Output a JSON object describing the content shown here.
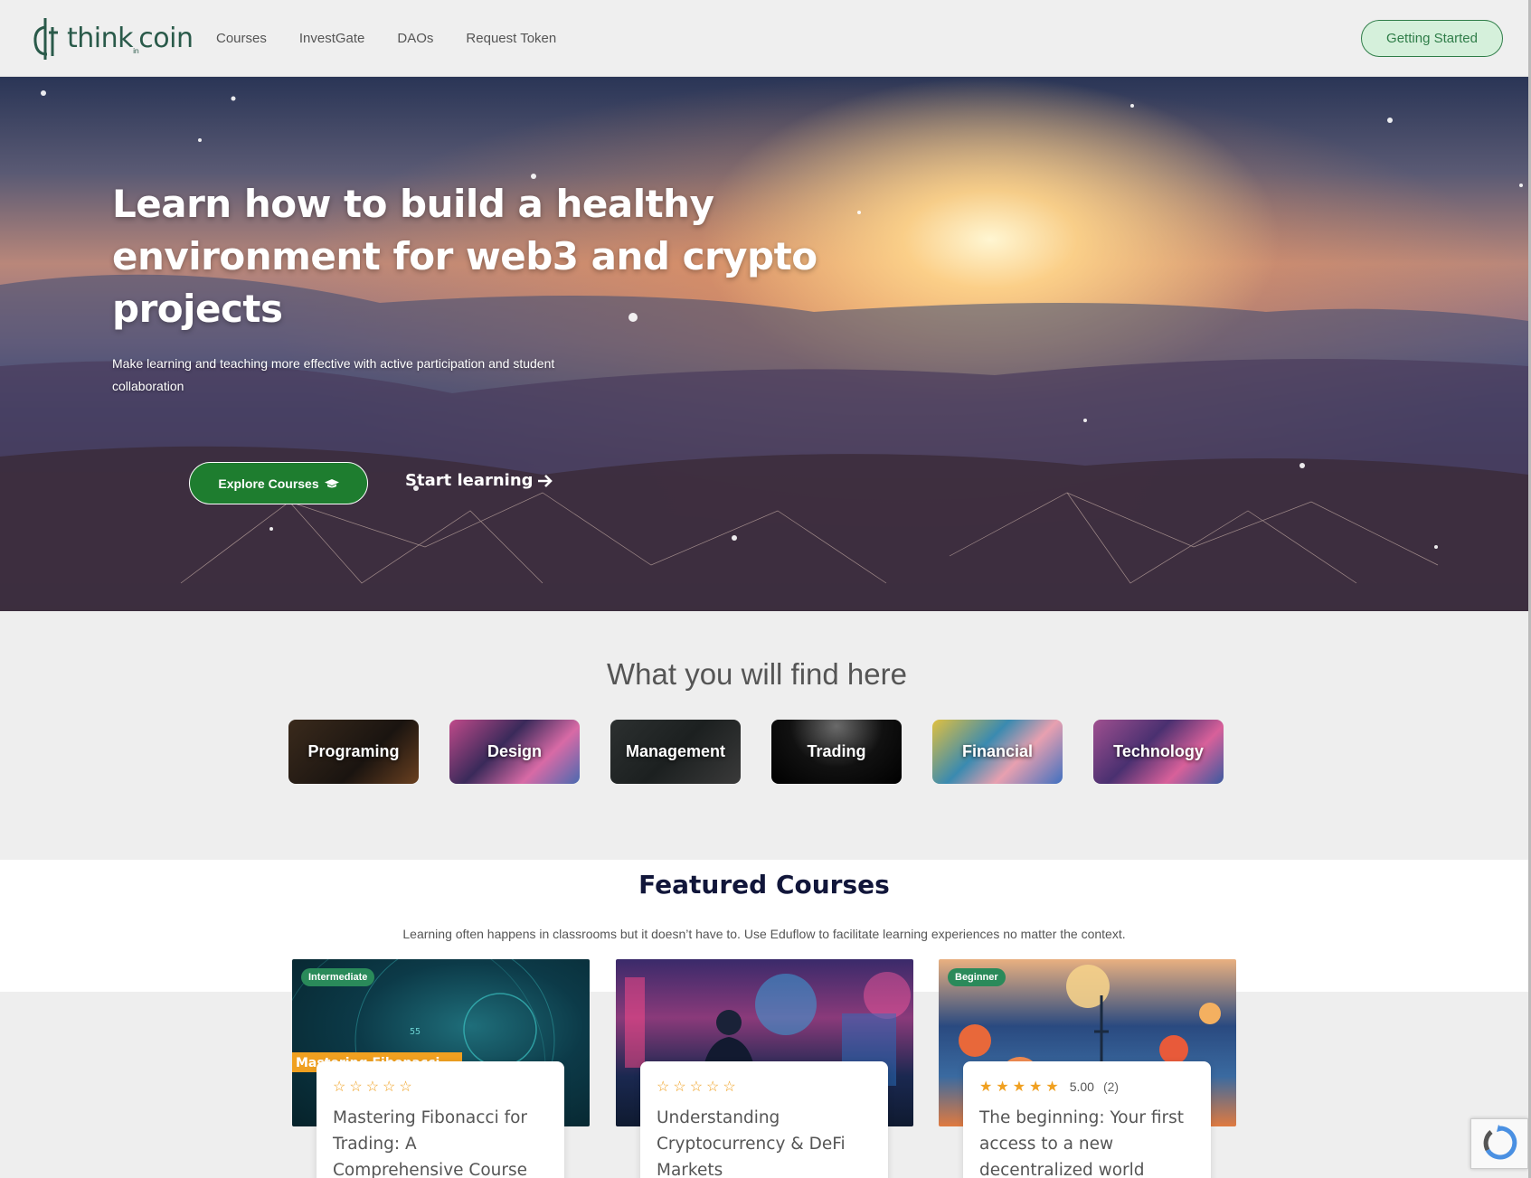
{
  "header": {
    "logo_text": "think",
    "logo_sub": "in",
    "logo_text2": "coin",
    "nav": [
      {
        "label": "Courses"
      },
      {
        "label": "InvestGate"
      },
      {
        "label": "DAOs"
      },
      {
        "label": "Request Token"
      }
    ],
    "cta_label": "Getting Started"
  },
  "hero": {
    "title": "Learn how to build a healthy environment for web3 and crypto projects",
    "subtitle": "Make learning and teaching more effective with active participation and student collaboration",
    "explore_label": "Explore Courses",
    "start_label": "Start learning",
    "icons": {
      "explore": "graduation-cap-icon",
      "start": "arrow-right-icon"
    }
  },
  "categories": {
    "title": "What you will find here",
    "items": [
      {
        "label": "Programing"
      },
      {
        "label": "Design"
      },
      {
        "label": "Management"
      },
      {
        "label": "Trading"
      },
      {
        "label": "Financial"
      },
      {
        "label": "Technology"
      }
    ]
  },
  "featured": {
    "title": "Featured Courses",
    "subtitle": "Learning often happens in classrooms but it doesn’t have to. Use Eduflow to facilitate learning experiences no matter the context.",
    "courses": [
      {
        "badge": "Intermediate",
        "stars_filled": 0,
        "rating": "",
        "count": "",
        "title": "Mastering Fibonacci for Trading: A Comprehensive Course",
        "image_text": "Mastering Fibonacci",
        "image_number": "55"
      },
      {
        "badge": "",
        "stars_filled": 0,
        "rating": "",
        "count": "",
        "title": "Understanding Cryptocurrency & DeFi Markets"
      },
      {
        "badge": "Beginner",
        "stars_filled": 5,
        "rating": "5.00",
        "count": "(2)",
        "title": "The beginning: Your first access to a new decentralized world"
      }
    ]
  },
  "colors": {
    "accent_green": "#1e7d2f",
    "cta_bg": "#d5f0db",
    "star": "#f0a020",
    "badge": "#2a8a5a",
    "heading_dark": "#11163a"
  }
}
